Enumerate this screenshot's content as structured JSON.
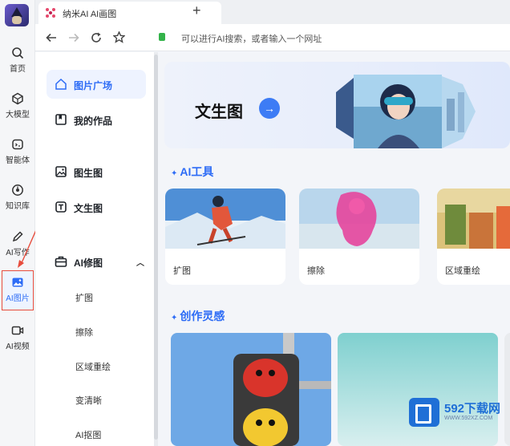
{
  "rail": {
    "items": [
      {
        "label": "首页",
        "icon": "search-icon"
      },
      {
        "label": "大模型",
        "icon": "cube-icon"
      },
      {
        "label": "智能体",
        "icon": "agent-icon"
      },
      {
        "label": "知识库",
        "icon": "knowledge-icon"
      },
      {
        "label": "AI写作",
        "icon": "pencil-icon"
      },
      {
        "label": "AI图片",
        "icon": "image-icon"
      },
      {
        "label": "AI视频",
        "icon": "video-icon"
      }
    ]
  },
  "browser": {
    "tab_title": "纳米AI   AI画图",
    "address_placeholder": "可以进行AI搜索，或者输入一个网址"
  },
  "sidebar": {
    "items": [
      {
        "label": "图片广场",
        "icon": "home-icon"
      },
      {
        "label": "我的作品",
        "icon": "bookmark-icon"
      },
      {
        "label": "图生图",
        "icon": "image-edit-icon"
      },
      {
        "label": "文生图",
        "icon": "text-image-icon"
      },
      {
        "label": "AI修图",
        "icon": "briefcase-icon"
      }
    ],
    "subitems": [
      "扩图",
      "擦除",
      "区域重绘",
      "变清晰",
      "AI抠图"
    ]
  },
  "main": {
    "hero_title": "文生图",
    "tools_title": "AI工具",
    "tools": [
      "扩图",
      "擦除",
      "区域重绘"
    ],
    "inspiration_title": "创作灵感"
  },
  "watermark": {
    "title": "592下载网",
    "sub": "WWW.592XZ.COM"
  },
  "colors": {
    "accent": "#2d6cf6",
    "highlight_border": "#e74c3c"
  }
}
